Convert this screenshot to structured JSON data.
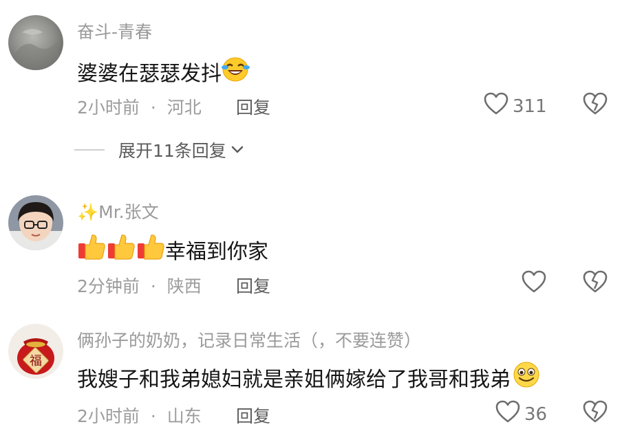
{
  "comments": [
    {
      "username": "奋斗-青春",
      "text": "婆婆在瑟瑟发抖",
      "emoji": "laughing-crying-emoji",
      "time": "2小时前",
      "location": "河北",
      "reply_label": "回复",
      "likes": "311"
    },
    {
      "username": "✨Mr.张文",
      "text": "幸福到你家",
      "emoji": "thumbs-up-emoji",
      "time": "2分钟前",
      "location": "陕西",
      "reply_label": "回复",
      "likes": ""
    },
    {
      "username": "俩孙子的奶奶，记录日常生活（，不要连赞）",
      "text": "我嫂子和我弟媳妇就是亲姐俩嫁给了我哥和我弟",
      "emoji": "grinning-emoji",
      "time": "2小时前",
      "location": "山东",
      "reply_label": "回复",
      "likes": "36"
    }
  ],
  "expand_replies": "展开11条回复",
  "separator": "·",
  "icons": {
    "like": "heart-outline-icon",
    "dislike": "broken-heart-icon",
    "expand": "chevron-down-icon"
  },
  "colors": {
    "text": "#161616",
    "meta": "#9c9c9c",
    "username": "#9a9a9a"
  }
}
